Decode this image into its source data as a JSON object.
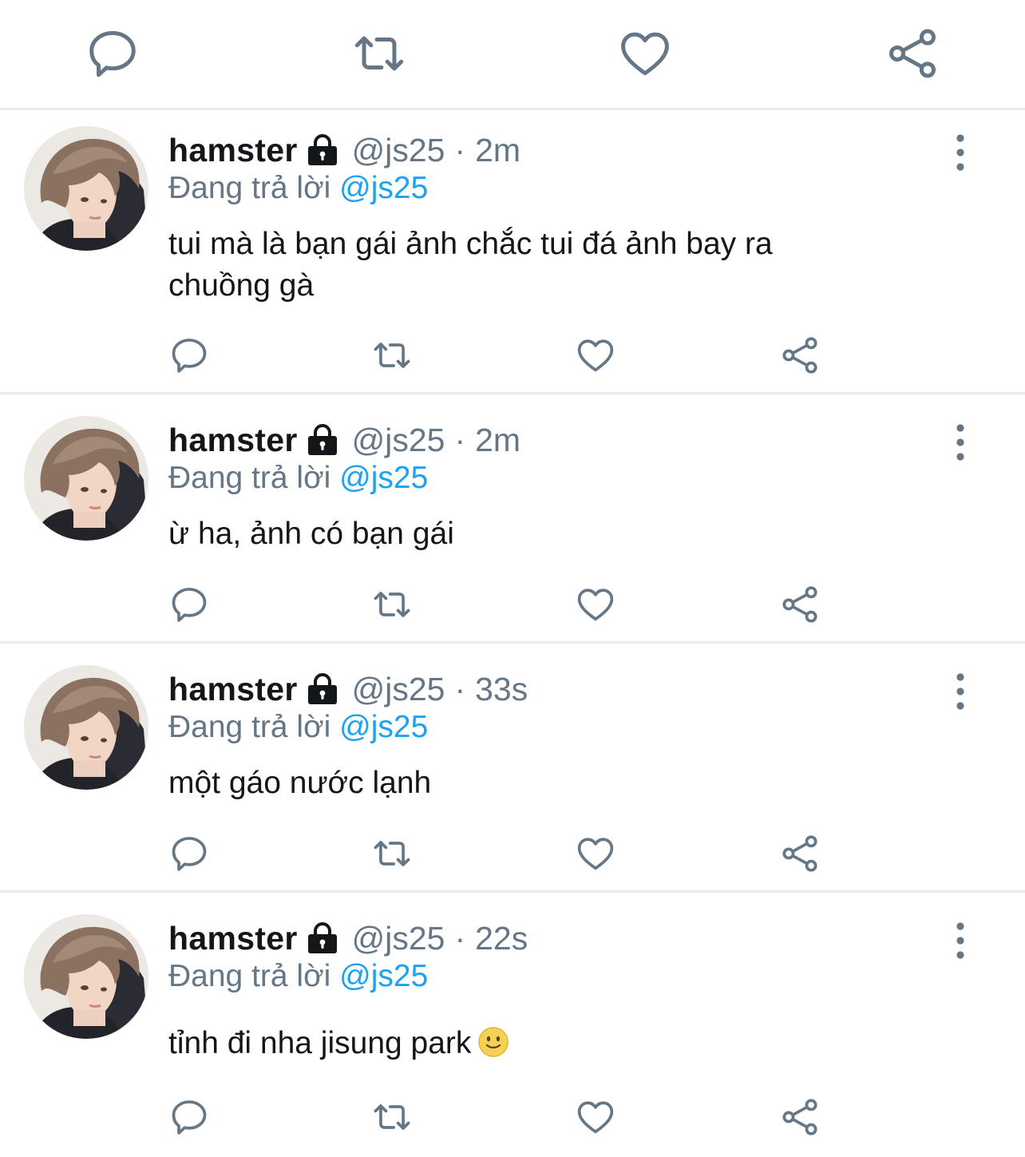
{
  "top_actions": {
    "icons": [
      "reply-icon",
      "retweet-icon",
      "like-icon",
      "share-icon"
    ]
  },
  "tweets": [
    {
      "name": "hamster",
      "handle": "@js25",
      "separator": "·",
      "time": "2m",
      "reply_prefix": "Đang trả lời",
      "reply_to": "@js25",
      "text": "tui mà là bạn gái ảnh chắc tui đá ảnh bay ra chuồng gà",
      "emoji": ""
    },
    {
      "name": "hamster",
      "handle": "@js25",
      "separator": "·",
      "time": "2m",
      "reply_prefix": "Đang trả lời",
      "reply_to": "@js25",
      "text": "ừ ha, ảnh có bạn gái",
      "emoji": ""
    },
    {
      "name": "hamster",
      "handle": "@js25",
      "separator": "·",
      "time": "33s",
      "reply_prefix": "Đang trả lời",
      "reply_to": "@js25",
      "text": "một gáo nước lạnh",
      "emoji": ""
    },
    {
      "name": "hamster",
      "handle": "@js25",
      "separator": "·",
      "time": "22s",
      "reply_prefix": "Đang trả lời",
      "reply_to": "@js25",
      "text": "tỉnh đi nha jisung park",
      "emoji": "slightly-smiling-face"
    }
  ],
  "colors": {
    "text": "#14171a",
    "secondary": "#657786",
    "link": "#1da1f2",
    "divider": "#e6ecf0"
  }
}
